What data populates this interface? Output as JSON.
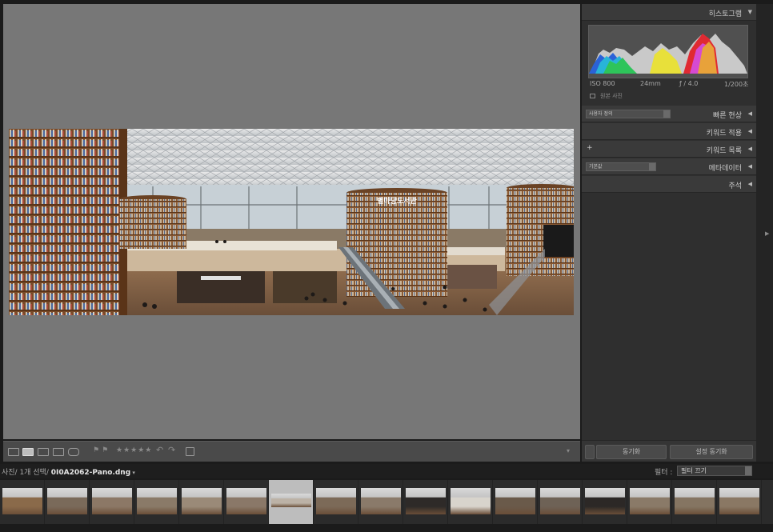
{
  "right_panel": {
    "histogram": {
      "title": "히스토그램",
      "iso": "ISO 800",
      "focal": "24mm",
      "aperture": "ƒ / 4.0",
      "shutter": "1/200초",
      "original_label": "원본 사진"
    },
    "quick_develop": {
      "title": "빠른 현상",
      "preset": "사용자 정의"
    },
    "keywording": {
      "title": "키워드 적용"
    },
    "keyword_list": {
      "title": "키워드 목록"
    },
    "metadata": {
      "title": "메타데이터",
      "preset": "기본값"
    },
    "comments": {
      "title": "주석"
    },
    "sync_label": "동기화",
    "sync_settings_label": "설정 동기화"
  },
  "toolbar": {
    "stars": "★★★★★"
  },
  "info_bar": {
    "path_prefix": "사진/ 1개 선택/",
    "filename": "0I0A2062-Pano.dng",
    "filter_label": "필터 :",
    "filter_value": "필터 끄기"
  },
  "filmstrip": {
    "thumb_count": 17,
    "selected_index": 6
  },
  "colors": {
    "viewport_bg": "#777777",
    "panel_bg": "#2f2f2f",
    "selection": "#bdbdbd"
  }
}
